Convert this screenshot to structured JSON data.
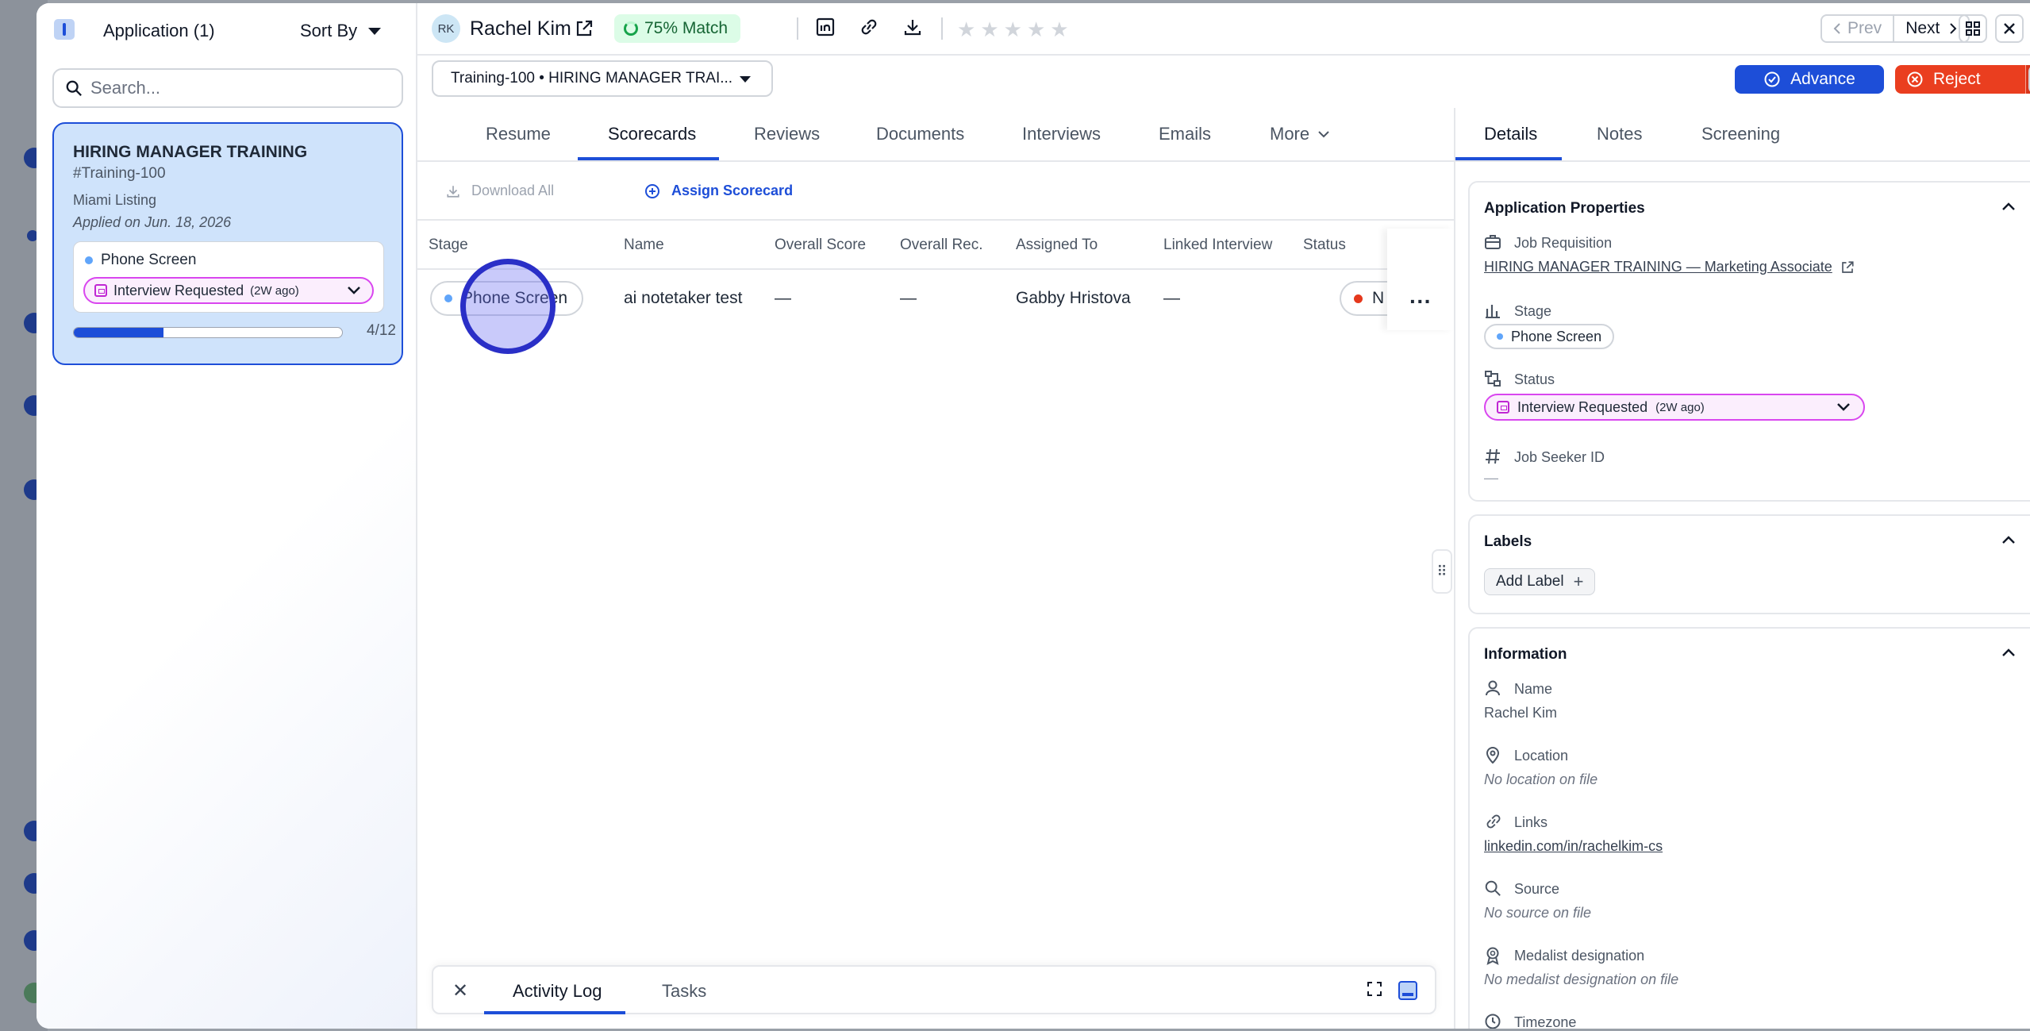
{
  "left_panel": {
    "title": "Application (1)",
    "sort_label": "Sort By",
    "search_placeholder": "Search...",
    "card": {
      "job_title": "HIRING MANAGER TRAINING",
      "job_id": "#Training-100",
      "location": "Miami Listing",
      "applied": "Applied on Jun. 18, 2026",
      "stage": "Phone Screen",
      "status": "Interview Requested",
      "status_ago": "(2W ago)",
      "progress_label": "4/12",
      "progress_fraction": 0.333
    }
  },
  "header": {
    "avatar_initials": "RK",
    "candidate_name": "Rachel Kim",
    "match": "75% Match",
    "prev_label": "Prev",
    "next_label": "Next",
    "rating_stars": 5
  },
  "job_select": {
    "value": "Training-100 • HIRING MANAGER TRAI..."
  },
  "actions": {
    "advance_label": "Advance",
    "reject_label": "Reject"
  },
  "tabs": [
    "Resume",
    "Scorecards",
    "Reviews",
    "Documents",
    "Interviews",
    "Emails",
    "More"
  ],
  "scorecards": {
    "download_all": "Download All",
    "assign": "Assign Scorecard",
    "columns": [
      "Stage",
      "Name",
      "Overall Score",
      "Overall Rec.",
      "Assigned To",
      "Linked Interview",
      "Status"
    ],
    "row": {
      "stage": "Phone Screen",
      "name": "ai notetaker test",
      "overall_score": "—",
      "overall_rec": "—",
      "assigned_to": "Gabby Hristova",
      "linked_interview": "—",
      "status": "N"
    }
  },
  "activity_bar": {
    "tab_activity": "Activity Log",
    "tab_tasks": "Tasks"
  },
  "right_panel": {
    "tabs": [
      "Details",
      "Notes",
      "Screening"
    ],
    "app_props": {
      "heading": "Application Properties",
      "job_req_label": "Job Requisition",
      "job_req_value": "HIRING MANAGER TRAINING — Marketing Associate",
      "stage_label": "Stage",
      "stage_value": "Phone Screen",
      "status_label": "Status",
      "status_value": "Interview Requested",
      "status_ago": "(2W ago)",
      "seeker_label": "Job Seeker ID",
      "seeker_value": "—"
    },
    "labels": {
      "heading": "Labels",
      "add_label": "Add Label"
    },
    "information": {
      "heading": "Information",
      "name_label": "Name",
      "name_value": "Rachel Kim",
      "location_label": "Location",
      "location_value": "No location on file",
      "links_label": "Links",
      "links_value": "linkedin.com/in/rachelkim-cs",
      "source_label": "Source",
      "source_value": "No source on file",
      "medalist_label": "Medalist designation",
      "medalist_value": "No medalist designation on file",
      "timezone_label": "Timezone"
    }
  },
  "colors": {
    "accent": "#1d4ed8",
    "reject": "#ea3e1f",
    "match_bg": "#dcfce7",
    "status_pink": "#d946ef"
  }
}
